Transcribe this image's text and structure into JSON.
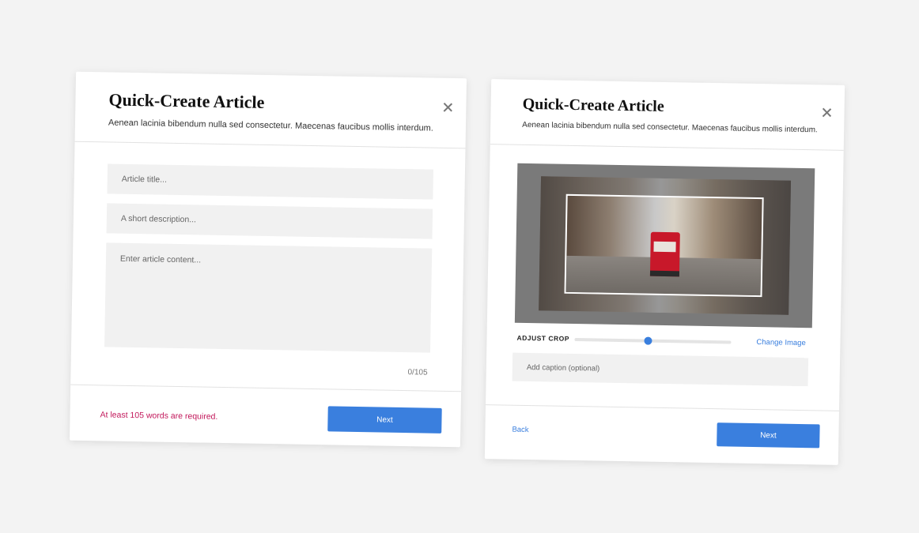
{
  "left_card": {
    "title": "Quick-Create Article",
    "subtitle": "Aenean lacinia bibendum nulla sed consectetur. Maecenas faucibus mollis interdum.",
    "title_placeholder": "Article title...",
    "description_placeholder": "A short description...",
    "content_placeholder": "Enter article content...",
    "word_counter": "0/105",
    "error_message": "At least 105 words are required.",
    "next_label": "Next"
  },
  "right_card": {
    "title": "Quick-Create Article",
    "subtitle": "Aenean lacinia bibendum nulla sed consectetur. Maecenas faucibus mollis interdum.",
    "adjust_crop_label": "ADJUST CROP",
    "crop_level": 0.47,
    "change_image_label": "Change Image",
    "caption_placeholder": "Add caption (optional)",
    "back_label": "Back",
    "next_label": "Next"
  },
  "colors": {
    "accent": "#3a7fde",
    "error": "#c2185b",
    "background": "#f3f3f3"
  },
  "icons": [
    "close-icon"
  ]
}
